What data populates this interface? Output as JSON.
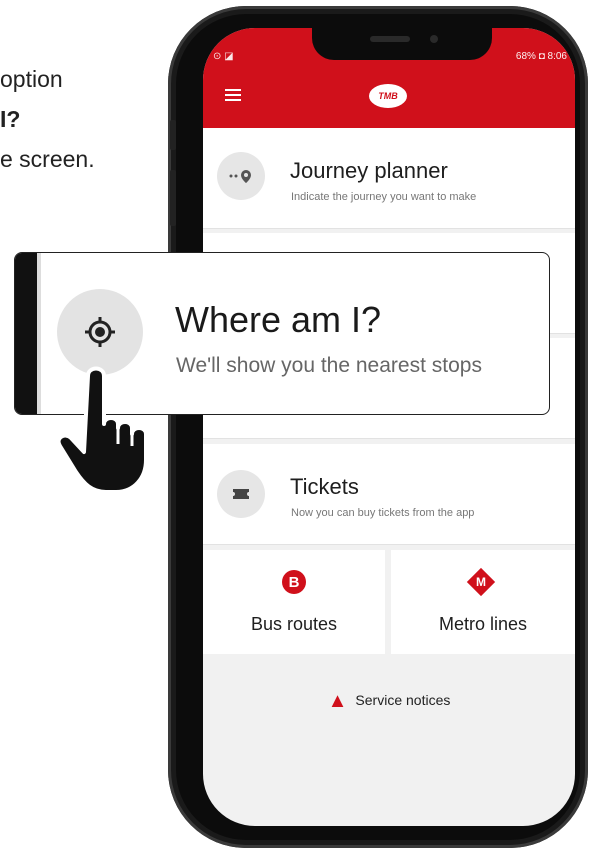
{
  "instructions": {
    "line1": "option",
    "line2": "I?",
    "line3": "e screen."
  },
  "status_bar": {
    "left": "⊙ ◪",
    "right": "68% ◘ 8:06"
  },
  "app_bar": {
    "logo_text": "TMB"
  },
  "menu": {
    "journey_planner": {
      "title": "Journey planner",
      "subtitle": "Indicate the journey you want to make"
    },
    "where_am_i": {
      "title": "Where am I?",
      "subtitle": "We'll show you the nearest stops"
    },
    "tickets": {
      "title": "Tickets",
      "subtitle": "Now you can buy tickets from the app"
    },
    "bus_routes": {
      "label": "Bus routes",
      "icon_letter": "B"
    },
    "metro_lines": {
      "label": "Metro lines",
      "icon_letter": "M"
    },
    "service_notices": {
      "label": "Service notices"
    }
  },
  "colors": {
    "brand_red": "#d0101b",
    "card_bg": "#ffffff",
    "screen_bg": "#f1f1f1"
  },
  "icons": {
    "journey": "route-icon",
    "location": "crosshair-location-icon",
    "tickets": "ticket-icon",
    "bus": "bus-icon",
    "metro": "metro-icon",
    "warning": "warning-icon",
    "hand": "pointing-hand-icon"
  }
}
